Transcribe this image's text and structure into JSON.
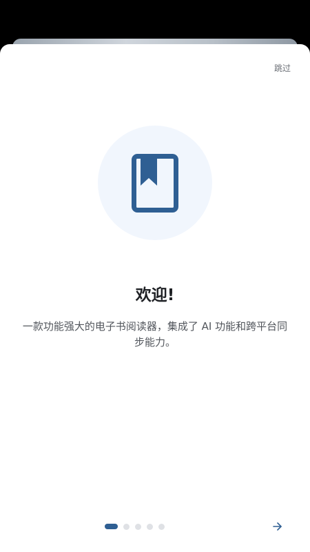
{
  "header": {
    "skip_label": "跳过"
  },
  "onboarding": {
    "title": "欢迎!",
    "description": "一款功能强大的电子书阅读器，集成了 AI 功能和跨平台同步能力。",
    "hero_icon": "book-bookmark-icon",
    "total_pages": 5,
    "current_page": 1
  },
  "navigation": {
    "next_icon": "arrow-right-icon"
  },
  "colors": {
    "accent": "#2f5f93",
    "hero_background": "#f1f6fd",
    "inactive_dot": "#dfe1e5",
    "title": "#1f2125",
    "text": "#52565c"
  }
}
